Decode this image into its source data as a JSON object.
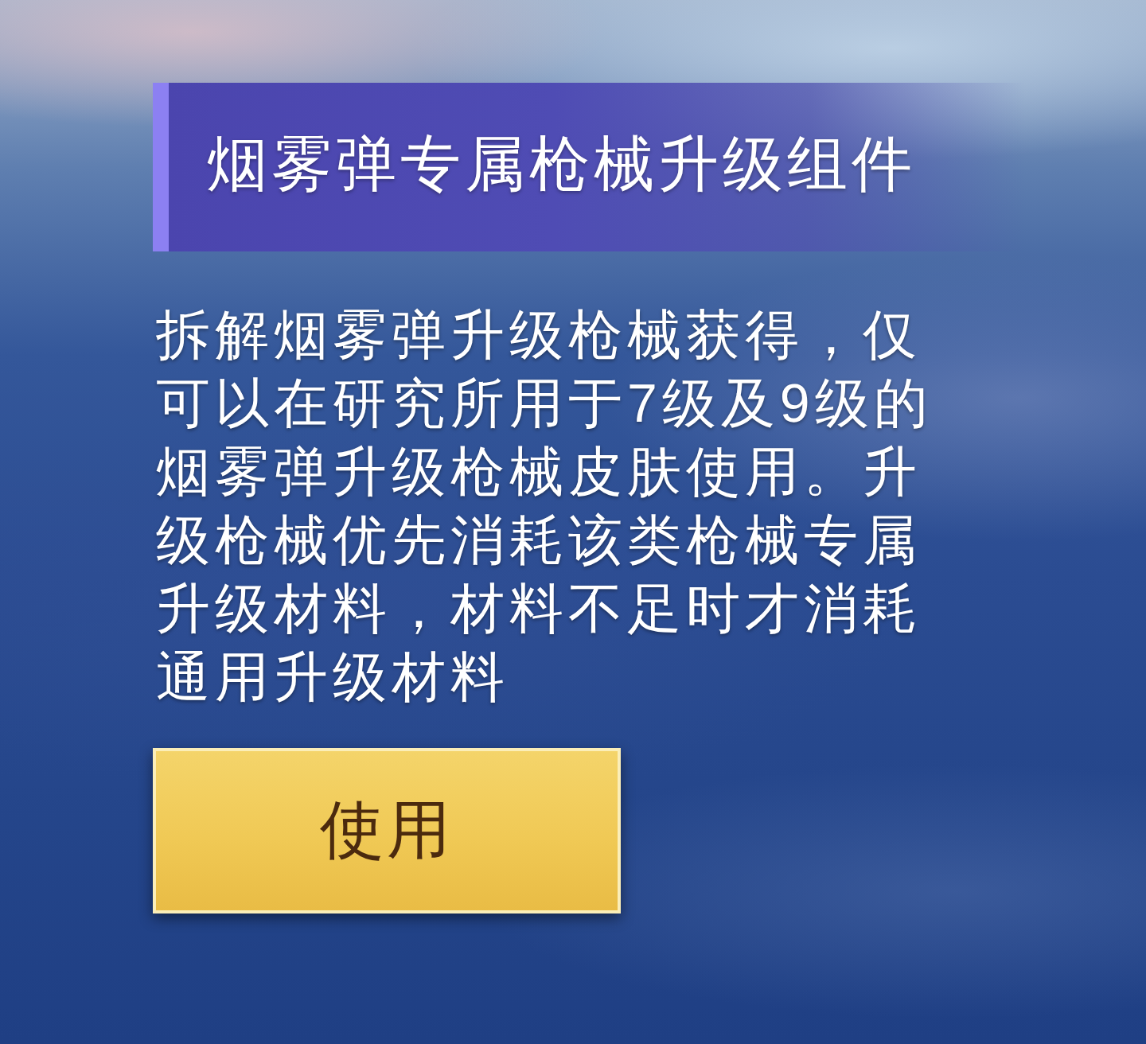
{
  "title": "烟雾弹专属枪械升级组件",
  "description": "拆解烟雾弹升级枪械获得，仅可以在研究所用于7级及9级的烟雾弹升级枪械皮肤使用。升级枪械优先消耗该类枪械专属升级材料，材料不足时才消耗通用升级材料",
  "button": {
    "label": "使用"
  }
}
